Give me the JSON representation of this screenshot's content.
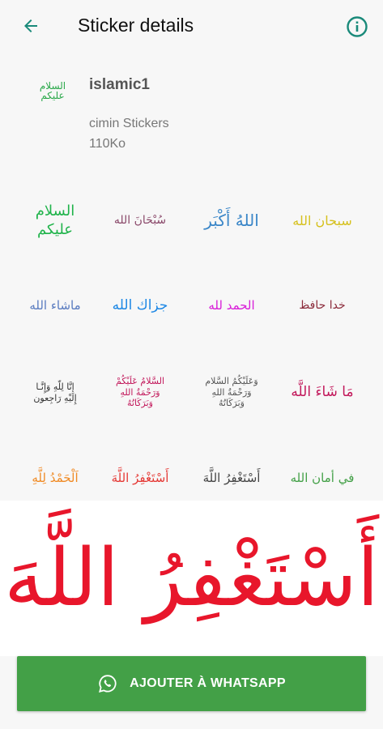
{
  "app_bar": {
    "title": "Sticker details",
    "back_icon": "arrow-left-icon",
    "info_icon": "info-circle-icon",
    "accent": "#1a8a7a"
  },
  "pack": {
    "thumb_line1": "السلام",
    "thumb_line2": "عليكم",
    "name": "islamic1",
    "publisher": "cimin Stickers",
    "size": "110Ko"
  },
  "stickers": [
    {
      "lines": [
        "السلام",
        "عليكم"
      ],
      "color": "#1fb34a"
    },
    {
      "lines": [
        "سُبْحَانَ الله"
      ],
      "color": "#8b4a6b"
    },
    {
      "lines": [
        "اللهُ أَكْبَر"
      ],
      "color": "#3a86c8"
    },
    {
      "lines": [
        "سبحان الله"
      ],
      "color": "#d6c11e"
    },
    {
      "lines": [
        "ماشاء الله"
      ],
      "color": "#5a7cc0"
    },
    {
      "lines": [
        "جزاك الله"
      ],
      "color": "#1e88e5"
    },
    {
      "lines": [
        "الحمد لله"
      ],
      "color": "#d81bd8"
    },
    {
      "lines": [
        "خدا حافظ"
      ],
      "color": "#8b2a3a"
    },
    {
      "lines": [
        "إنَّا لِلّهِ وَإِنَّـا",
        "إِلَيْهِ رَاجِعون"
      ],
      "color": "#333333"
    },
    {
      "lines": [
        "السَّلامُ عَلَيْكُمْ",
        "وَرَحْمَةُ اللهِ",
        "وَبَرَكَاتُهُ"
      ],
      "color": "#c2185b"
    },
    {
      "lines": [
        "وَعَلَيْكُمُ السَّلام",
        "وَرَحْمَةُ اللهِ",
        "وَبَرَكَاتُهُ"
      ],
      "color": "#555555"
    },
    {
      "lines": [
        "مَا شَاءَ اللَّه"
      ],
      "color": "#c2185b"
    },
    {
      "lines": [
        "اَلْحَمْدُ لِلَّهِ"
      ],
      "color": "#f08a24"
    },
    {
      "lines": [
        "أَسْتَغْفِرُ اللَّهَ"
      ],
      "color": "#e53935"
    },
    {
      "lines": [
        "أَسْتَغْفِرُ اللَّهَ"
      ],
      "color": "#444444"
    },
    {
      "lines": [
        "في أمان الله"
      ],
      "color": "#43a047"
    }
  ],
  "preview": {
    "text": "أَسْتَغْفِرُ اللَّهَ",
    "color": "#e8162b"
  },
  "add_button": {
    "label": "AJOUTER À WHATSAPP",
    "icon": "whatsapp-icon",
    "color": "#43a047"
  }
}
